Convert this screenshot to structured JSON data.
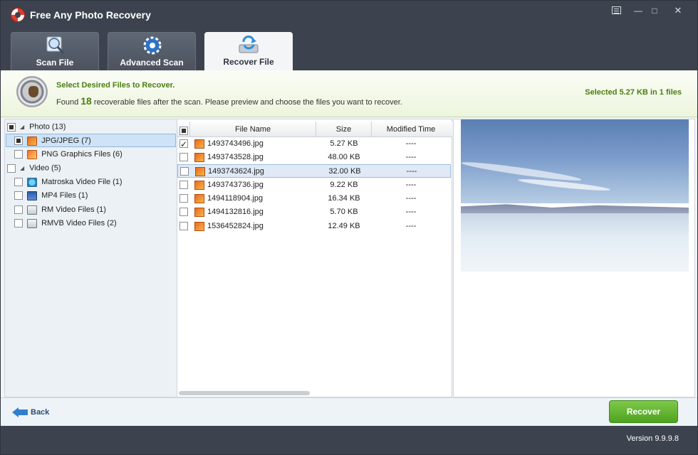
{
  "window": {
    "title": "Free Any Photo Recovery",
    "controls": {
      "menu": "",
      "minimize": "—",
      "maximize": "□",
      "close": "✕"
    }
  },
  "tabs": [
    {
      "label": "Scan File",
      "icon": "magnifier-icon",
      "active": false
    },
    {
      "label": "Advanced Scan",
      "icon": "gear-icon",
      "active": false
    },
    {
      "label": "Recover File",
      "icon": "recover-icon",
      "active": true
    }
  ],
  "banner": {
    "title": "Select Desired Files to Recover.",
    "desc_prefix": "Found",
    "count": "18",
    "desc_suffix": "recoverable files after the scan. Please preview and choose the files you want to recover.",
    "selected": "Selected 5.27 KB in 1 files",
    "accent": "#4a7f10"
  },
  "tree": {
    "groups": [
      {
        "label": "Photo (13)",
        "items": [
          {
            "label": "JPG/JPEG (7)",
            "icon": "jpg-icon",
            "selected": true
          },
          {
            "label": "PNG Graphics Files (6)",
            "icon": "png-icon",
            "selected": false
          }
        ]
      },
      {
        "label": "Video (5)",
        "items": [
          {
            "label": "Matroska Video File (1)",
            "icon": "mkv-icon",
            "selected": false
          },
          {
            "label": "MP4 Files (1)",
            "icon": "mp4-icon",
            "selected": false
          },
          {
            "label": "RM Video Files (1)",
            "icon": "rm-icon",
            "selected": false
          },
          {
            "label": "RMVB Video Files (2)",
            "icon": "rmvb-icon",
            "selected": false
          }
        ]
      }
    ]
  },
  "table": {
    "headers": {
      "name": "File Name",
      "size": "Size",
      "modified": "Modified Time"
    },
    "rows": [
      {
        "name": "1493743496.jpg",
        "size": "5.27 KB",
        "modified": "----",
        "checked": true,
        "highlighted": false
      },
      {
        "name": "1493743528.jpg",
        "size": "48.00 KB",
        "modified": "----",
        "checked": false,
        "highlighted": false
      },
      {
        "name": "1493743624.jpg",
        "size": "32.00 KB",
        "modified": "----",
        "checked": false,
        "highlighted": true
      },
      {
        "name": "1493743736.jpg",
        "size": "9.22 KB",
        "modified": "----",
        "checked": false,
        "highlighted": false
      },
      {
        "name": "1494118904.jpg",
        "size": "16.34 KB",
        "modified": "----",
        "checked": false,
        "highlighted": false
      },
      {
        "name": "1494132816.jpg",
        "size": "5.70 KB",
        "modified": "----",
        "checked": false,
        "highlighted": false
      },
      {
        "name": "1536452824.jpg",
        "size": "12.49 KB",
        "modified": "----",
        "checked": false,
        "highlighted": false
      }
    ]
  },
  "bottom": {
    "back_label": "Back",
    "recover_label": "Recover",
    "recover_color": "#4ea31f"
  },
  "footer": {
    "version": "Version 9.9.9.8"
  }
}
